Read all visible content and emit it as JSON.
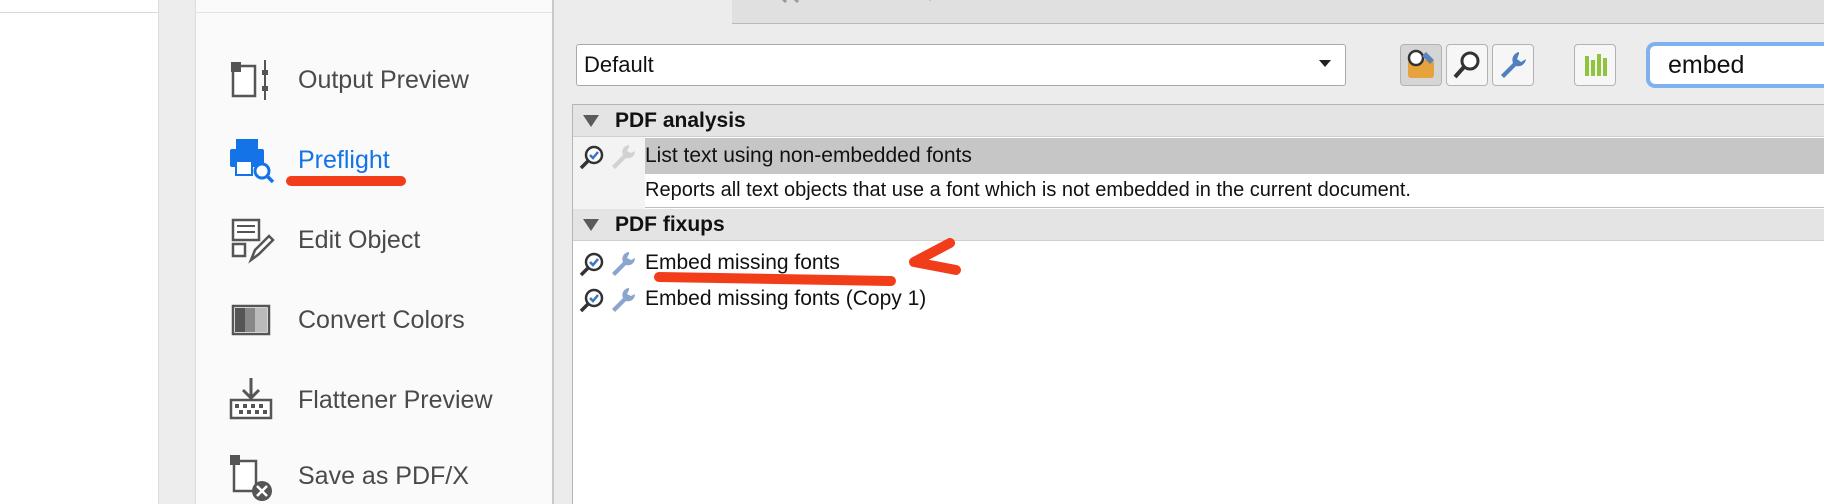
{
  "tools": {
    "items": [
      {
        "label": "Output Preview",
        "icon": "output-preview-icon",
        "active": false
      },
      {
        "label": "Preflight",
        "icon": "preflight-icon",
        "active": true
      },
      {
        "label": "Edit Object",
        "icon": "edit-object-icon",
        "active": false
      },
      {
        "label": "Convert Colors",
        "icon": "convert-colors-icon",
        "active": false
      },
      {
        "label": "Flattener Preview",
        "icon": "flattener-preview-icon",
        "active": false
      },
      {
        "label": "Save as PDF/X",
        "icon": "save-pdfx-icon",
        "active": false
      }
    ],
    "active_color": "#1473e6"
  },
  "dialog": {
    "profile_select": {
      "value": "Default"
    },
    "search": {
      "value": "embed"
    },
    "groups": [
      {
        "title": "PDF analysis",
        "rows": [
          {
            "label": "List text using non-embedded fonts",
            "description": "Reports all text objects that use a font which is not embedded in the current document.",
            "selected": true
          }
        ]
      },
      {
        "title": "PDF fixups",
        "rows": [
          {
            "label": "Embed missing fonts",
            "selected": false
          },
          {
            "label": "Embed missing fonts (Copy 1)",
            "selected": false
          }
        ]
      }
    ]
  },
  "annotation_color": "#f23d1a"
}
